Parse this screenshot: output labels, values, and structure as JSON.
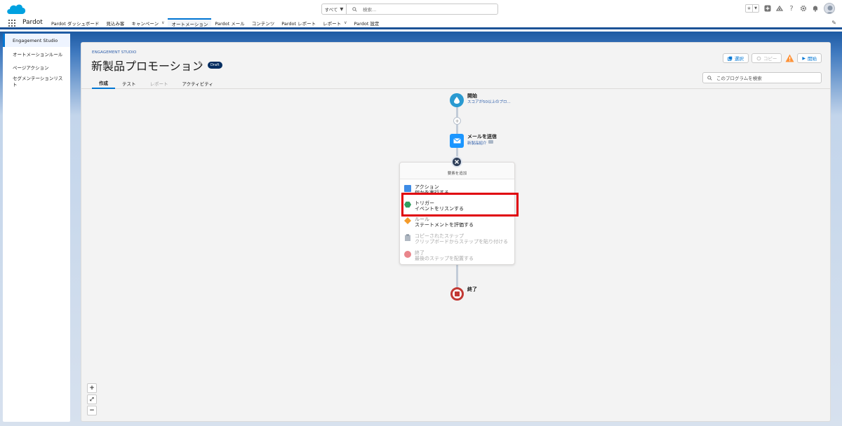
{
  "search": {
    "scope": "すべて",
    "placeholder": "検索..."
  },
  "nav": {
    "app_name": "Pardot",
    "items": [
      {
        "label": "Pardot ダッシュボード"
      },
      {
        "label": "見込み客"
      },
      {
        "label": "キャンペーン"
      },
      {
        "label": "オートメーション"
      },
      {
        "label": "Pardot メール"
      },
      {
        "label": "コンテンツ"
      },
      {
        "label": "Pardot レポート"
      },
      {
        "label": "レポート"
      },
      {
        "label": "Pardot 設定"
      }
    ]
  },
  "sidebar": {
    "items": [
      {
        "label": "Engagement Studio"
      },
      {
        "label": "オートメーションルール"
      },
      {
        "label": "ページアクション"
      },
      {
        "label": "セグメンテーションリスト"
      }
    ]
  },
  "header": {
    "eyebrow": "ENGAGEMENT STUDIO",
    "title": "新製品プロモーション",
    "badge": "Draft",
    "tabs": [
      {
        "label": "作成"
      },
      {
        "label": "テスト"
      },
      {
        "label": "レポート"
      },
      {
        "label": "アクティビティ"
      }
    ],
    "buttons": {
      "select": "選択",
      "copy": "コピー",
      "start": "開始"
    },
    "program_search_placeholder": "このプログラムを検索"
  },
  "flow": {
    "start": {
      "label": "開始",
      "sub": "スコアが50以上のプロ..."
    },
    "email": {
      "label": "メールを送信",
      "sub": "新製品紹介"
    },
    "add_menu": {
      "title": "要素を追加",
      "items": [
        {
          "title": "アクション",
          "desc": "何かを実行する"
        },
        {
          "title": "トリガー",
          "desc": "イベントをリスンする"
        },
        {
          "title": "ルール",
          "desc": "ステートメントを評価する"
        },
        {
          "title": "コピーされたステップ",
          "desc": "クリップボードからステップを貼り付ける"
        },
        {
          "title": "終了",
          "desc": "最後のステップを配置する"
        }
      ]
    },
    "end": {
      "label": "終了"
    }
  },
  "colors": {
    "brand_blue": "#0176d3",
    "header_band": "#1b5297",
    "start_node": "#2a9ad1",
    "email_node": "#1b96ff",
    "end_node": "#c23934",
    "trigger": "#2e9e5e",
    "rule": "#f49b2a",
    "highlight": "#e0000b"
  },
  "zoom": {
    "in": "+",
    "fit": "⤢",
    "out": "−"
  }
}
